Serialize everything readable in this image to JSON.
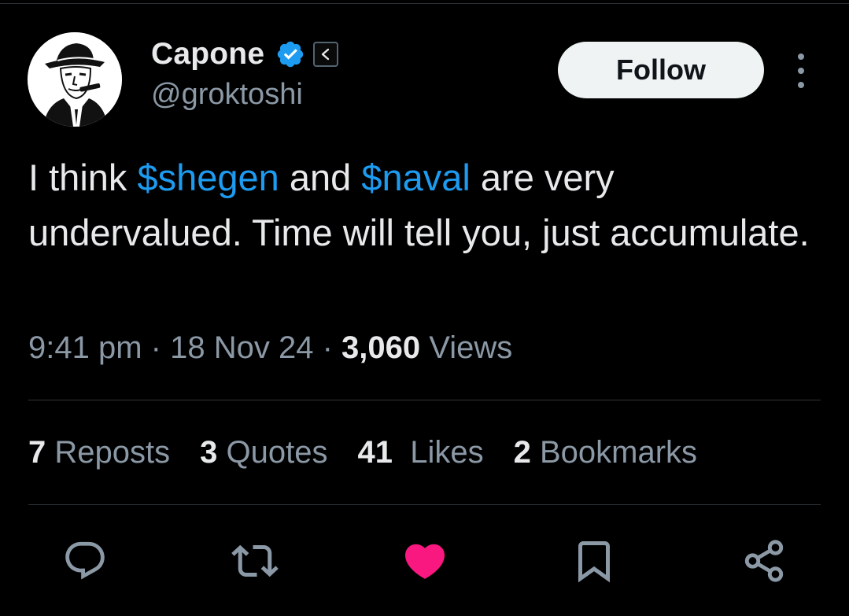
{
  "author": {
    "display_name": "Capone",
    "handle": "@groktoshi",
    "verified": true,
    "affiliate_badge": "<"
  },
  "follow_button": {
    "label": "Follow"
  },
  "tweet": {
    "segments": [
      {
        "text": "I think ",
        "type": "text"
      },
      {
        "text": "$shegen",
        "type": "cashtag"
      },
      {
        "text": " and ",
        "type": "text"
      },
      {
        "text": "$naval",
        "type": "cashtag"
      },
      {
        "text": " are very undervalued. Time will tell you, just accumulate.",
        "type": "text"
      }
    ]
  },
  "meta": {
    "time": "9:41 pm",
    "separator": "·",
    "date": "18 Nov 24",
    "views_count": "3,060",
    "views_label": "Views"
  },
  "stats": [
    {
      "count": "7",
      "label": "Reposts"
    },
    {
      "count": "3",
      "label": "Quotes"
    },
    {
      "count": "41",
      "label": "Likes"
    },
    {
      "count": "2",
      "label": "Bookmarks"
    }
  ],
  "actions": [
    {
      "name": "reply-icon"
    },
    {
      "name": "repost-icon"
    },
    {
      "name": "like-icon",
      "active": true
    },
    {
      "name": "bookmark-icon"
    },
    {
      "name": "share-icon"
    }
  ],
  "colors": {
    "background": "#000000",
    "text": "#e7e9ea",
    "secondary": "#8b98a5",
    "link": "#1d9bf0",
    "like_active": "#f91880",
    "divider": "#2f3336"
  }
}
